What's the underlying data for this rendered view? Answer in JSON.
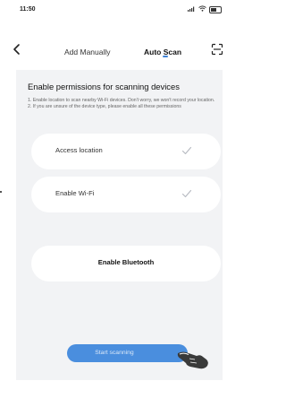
{
  "status_bar": {
    "time": "11:50",
    "icons": [
      "signal-icon",
      "wifi-icon",
      "battery-icon"
    ]
  },
  "nav": {
    "back_icon": "chevron-left-icon",
    "tabs": [
      {
        "label": "Add Manually",
        "active": false
      },
      {
        "label": "Auto Scan",
        "active": true
      }
    ],
    "scan_icon": "scan-frame-icon",
    "accent_color": "#3f83d6"
  },
  "main": {
    "title": "Enable permissions for scanning devices",
    "hints": [
      "1. Enable location to scan nearby Wi-Fi devices. Don't worry, we won't record your location.",
      "2. If you are unsure of the device type, please enable all these permissions"
    ],
    "permissions": [
      {
        "label": "Access location",
        "granted": true,
        "icon": "check-icon"
      },
      {
        "label": "Enable Wi-Fi",
        "granted": true,
        "icon": "check-icon"
      },
      {
        "label": "Enable Bluetooth",
        "granted": false
      }
    ],
    "start_button": {
      "label": "Start scanning",
      "color": "#4a8ede"
    },
    "pointer_icon": "hand-pointer-icon"
  }
}
